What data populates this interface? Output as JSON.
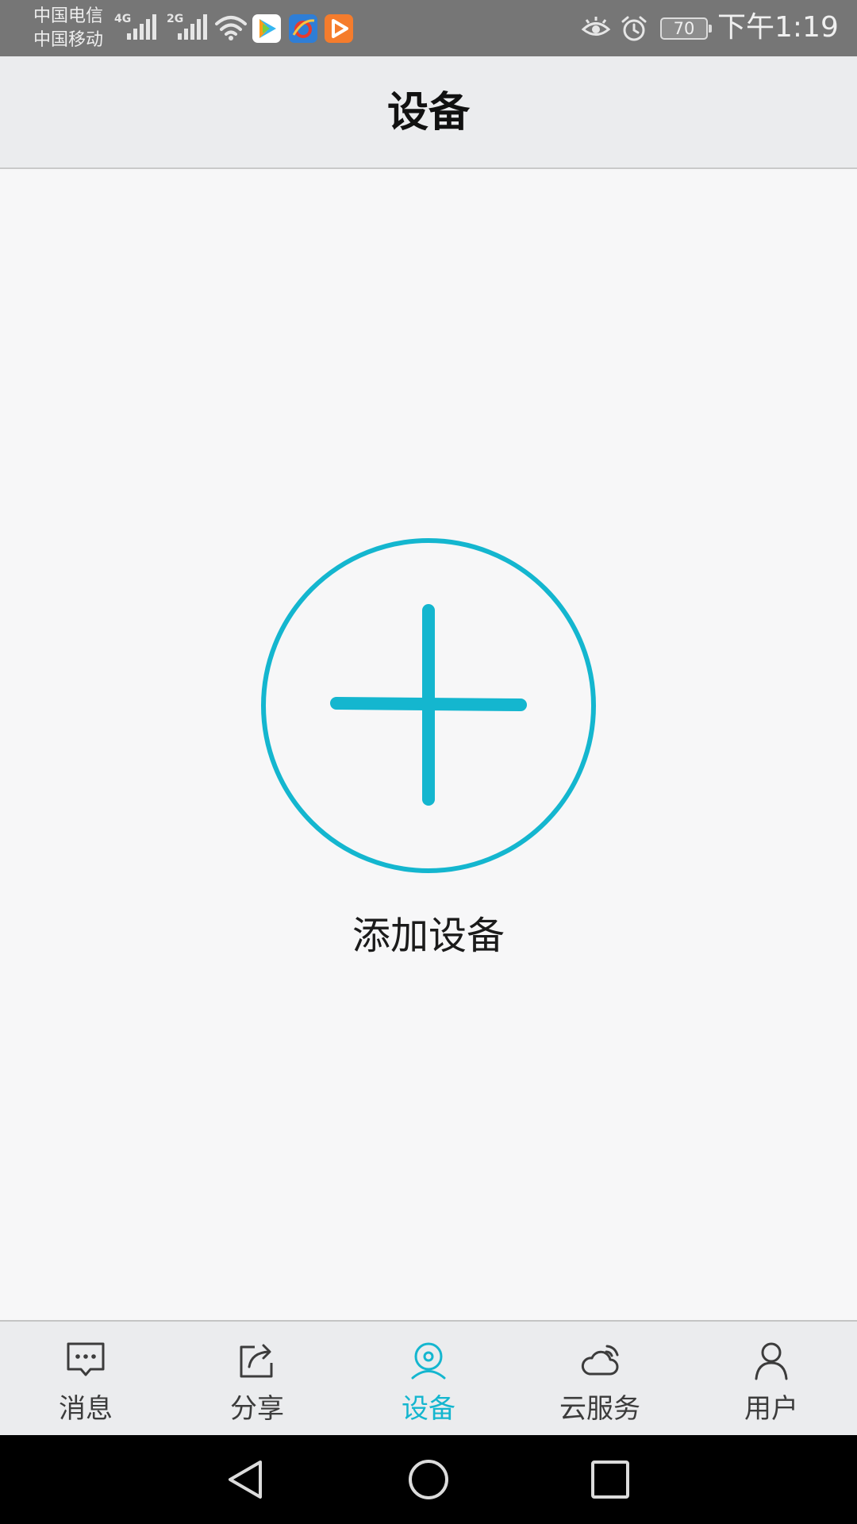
{
  "status_bar": {
    "carrier_1": "中国电信",
    "carrier_2": "中国移动",
    "network_1": "4G",
    "network_2": "2G",
    "battery_level": "70",
    "time": "下午1:19",
    "icons": [
      "signal-icon",
      "wifi-icon",
      "tencent-video-icon",
      "browser-icon",
      "video-app-icon",
      "eye-comfort-icon",
      "alarm-icon",
      "battery-icon"
    ]
  },
  "header": {
    "title": "设备"
  },
  "main": {
    "add_device_label": "添加设备",
    "add_icon": "plus-circle-icon"
  },
  "bottom_nav": {
    "items": [
      {
        "label": "消息",
        "icon": "message-icon",
        "active": false
      },
      {
        "label": "分享",
        "icon": "share-icon",
        "active": false
      },
      {
        "label": "设备",
        "icon": "device-icon",
        "active": true
      },
      {
        "label": "云服务",
        "icon": "cloud-icon",
        "active": false
      },
      {
        "label": "用户",
        "icon": "user-icon",
        "active": false
      }
    ]
  },
  "system_nav": {
    "icons": [
      "back-icon",
      "home-icon",
      "recents-icon"
    ]
  },
  "colors": {
    "accent": "#14b6cf",
    "status_bar": "#767676",
    "header_bg": "#ebecee",
    "content_bg": "#f7f7f8",
    "text_primary": "#111111",
    "nav_text": "#3c3c3c"
  }
}
